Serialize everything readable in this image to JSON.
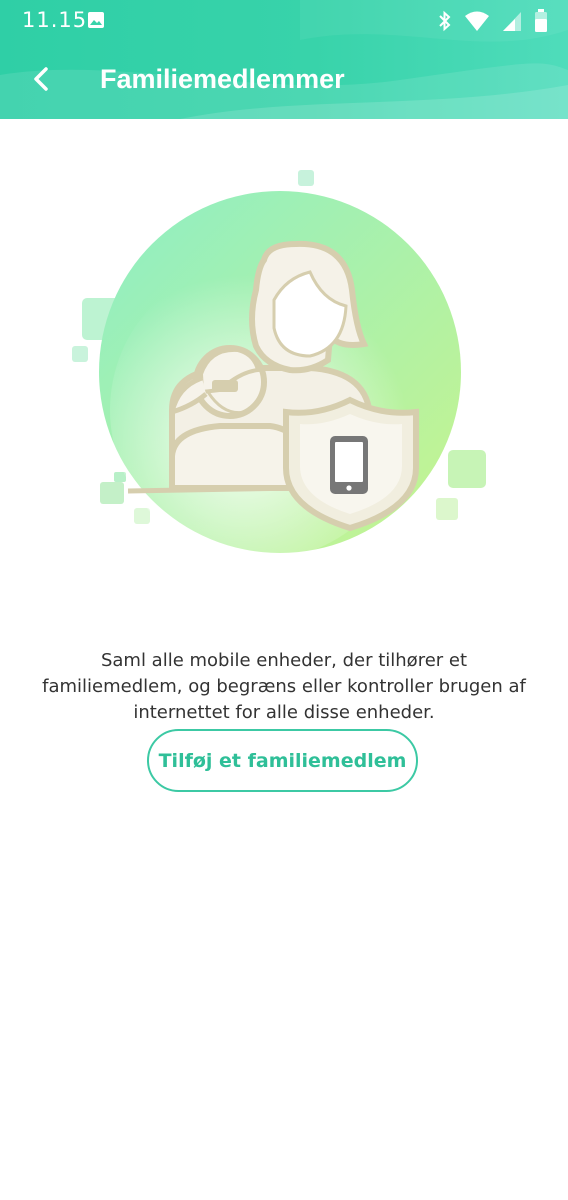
{
  "status_bar": {
    "time": "11.15",
    "icons": [
      "image-notification-icon",
      "bluetooth-icon",
      "wifi-icon",
      "signal-icon",
      "battery-icon"
    ]
  },
  "app_bar": {
    "title": "Familiemedlemmer",
    "back_icon": "chevron-left-icon"
  },
  "illustration": {
    "subject": "family-members-shield-phone",
    "colors": {
      "circle_start": "#8eeec5",
      "circle_end": "#c4f28f",
      "figure": "#f4f1e6",
      "outline": "#d8d1b3",
      "phone": "#777777"
    }
  },
  "main": {
    "description": "Saml alle mobile enheder, der tilhører et familiemedlem, og begræns eller kontroller brugen af internettet for alle disse enheder.",
    "add_button_label": "Tilføj et familiemedlem"
  },
  "colors": {
    "accent": "#3cc9a4",
    "header": "#35d1a8",
    "text": "#333333"
  }
}
